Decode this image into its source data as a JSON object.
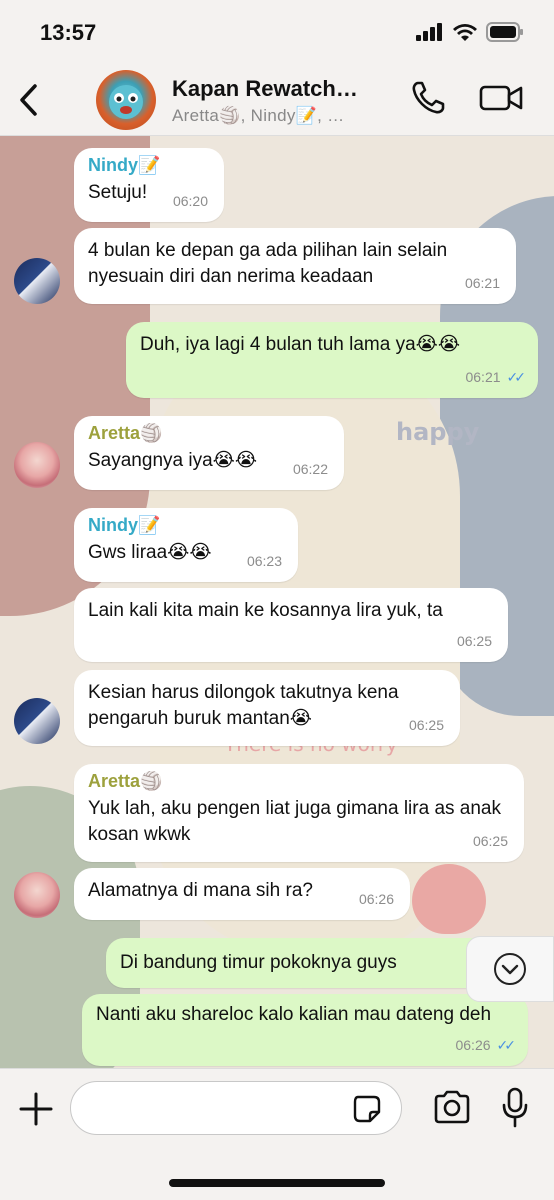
{
  "status_bar": {
    "time": "13:57"
  },
  "header": {
    "title": "Kapan Rewatch…",
    "members": "Aretta🏐, Nindy📝, …"
  },
  "messages": [
    {
      "sender": "Nindy📝",
      "text": "Setuju!",
      "time": "06:20"
    },
    {
      "text": "4 bulan ke depan ga ada pilihan lain selain nyesuain diri dan nerima keadaan",
      "time": "06:21"
    },
    {
      "text": "Duh, iya lagi 4 bulan tuh lama ya😭😭",
      "time": "06:21"
    },
    {
      "sender": "Aretta🏐",
      "text": "Sayangnya iya😭😭",
      "time": "06:22"
    },
    {
      "sender": "Nindy📝",
      "text": "Gws liraa😭😭",
      "time": "06:23"
    },
    {
      "text": "Lain kali kita main ke kosannya lira yuk, ta",
      "time": "06:25"
    },
    {
      "text": "Kesian harus dilongok takutnya kena pengaruh buruk mantan😭",
      "time": "06:25"
    },
    {
      "sender": "Aretta🏐",
      "text": "Yuk lah, aku pengen liat juga gimana lira as anak kosan wkwk",
      "time": "06:25"
    },
    {
      "text": "Alamatnya di mana sih ra?",
      "time": "06:26"
    },
    {
      "text": "Di bandung timur pokoknya guys",
      "time": "06"
    },
    {
      "text": "Nanti aku shareloc kalo kalian mau dateng deh",
      "time": "06:26"
    }
  ],
  "wallpaper": {
    "text_1": "happy",
    "text_2": "There is no worry"
  },
  "colors": {
    "incoming_bubble": "#ffffff",
    "outgoing_bubble": "#dcf8c6",
    "nindy_name": "#35aac7",
    "aretta_name": "#9da13d",
    "read_receipt": "#4a90e2"
  },
  "icons": {
    "back": "chevron-left-icon",
    "call": "phone-icon",
    "video": "video-camera-icon",
    "scroll_down": "chevron-down-icon",
    "attach": "plus-icon",
    "sticker": "sticker-icon",
    "camera": "camera-icon",
    "mic": "microphone-icon"
  }
}
